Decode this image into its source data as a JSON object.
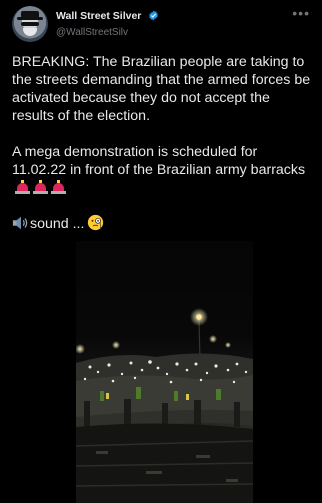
{
  "tweet": {
    "author": {
      "display_name": "Wall Street Silver",
      "handle": "@WallStreetSilv",
      "avatar_icon": "avatar-image",
      "verified_icon": "verified-badge-icon"
    },
    "more_options_icon": "more-options-icon",
    "paragraphs": [
      "BREAKING: The Brazilian people are taking to the streets demanding that the armed forces be activated because they do not accept the results of the election.",
      "A mega demonstration is scheduled for 11.02.22 in front of the Brazilian army barracks"
    ],
    "siren_icon": "police-car-light-icon",
    "siren_count": 3,
    "sound_text": "sound ...",
    "speaker_icon": "speaker-icon",
    "face_icon": "face-with-monocle-icon",
    "media": {
      "kind": "video",
      "description_icon": "night-crowd-video-thumbnail"
    }
  },
  "colors": {
    "background": "#000000",
    "text": "#e7e9ea",
    "secondary_text": "#71767b",
    "verified": "#1d9bf0",
    "siren": "#e0245e"
  }
}
